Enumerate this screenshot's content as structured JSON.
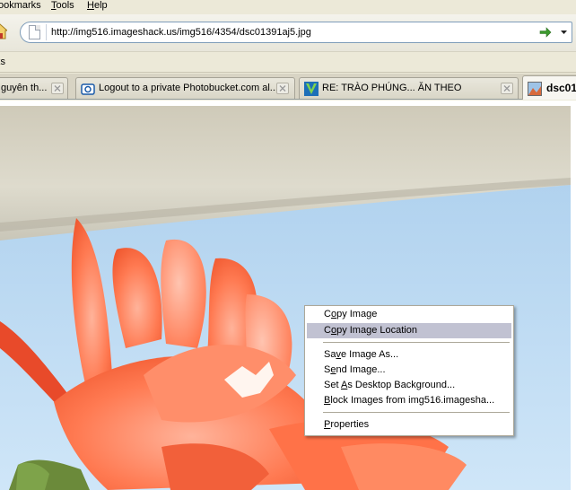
{
  "menubar": {
    "bookmarks": "ookmarks",
    "tools": "Tools",
    "help": "Help"
  },
  "navbar": {
    "url": "http://img516.imageshack.us/img516/4354/dsc01391aj5.jpg",
    "go_icon": "green-arrow-icon",
    "dropdown_icon": "chevron-down-icon"
  },
  "bookmarks_toolbar": {
    "label": "ks"
  },
  "tabs": [
    {
      "label": "guyên th...",
      "favicon": "none",
      "active": false
    },
    {
      "label": "Logout to a private Photobucket.com al...",
      "favicon": "photobucket-icon",
      "active": false
    },
    {
      "label": "RE: TRÀO PHÚNG... ĂN THEO",
      "favicon": "v-logo-icon",
      "active": false
    },
    {
      "label": "dsc01",
      "favicon": "image-icon",
      "active": true
    }
  ],
  "context_menu": {
    "items": [
      {
        "label": "Copy Image",
        "accesskey_index": 1,
        "highlighted": false
      },
      {
        "label": "Copy Image Location",
        "accesskey_index": 1,
        "highlighted": true
      },
      {
        "label": "Save Image As...",
        "accesskey_index": 2,
        "highlighted": false
      },
      {
        "label": "Send Image...",
        "accesskey_index": 1,
        "highlighted": false
      },
      {
        "label": "Set As Desktop Background...",
        "accesskey_index": 4,
        "highlighted": false
      },
      {
        "label": "Block Images from img516.imagesha...",
        "accesskey_index": 0,
        "highlighted": false
      },
      {
        "label": "Properties",
        "accesskey_index": 0,
        "highlighted": false
      }
    ]
  },
  "colors": {
    "menu_highlight": "#c1c2d2",
    "chrome": "#ece9d8",
    "sky": "#bcdcf4",
    "petal": "#ff7a52"
  }
}
